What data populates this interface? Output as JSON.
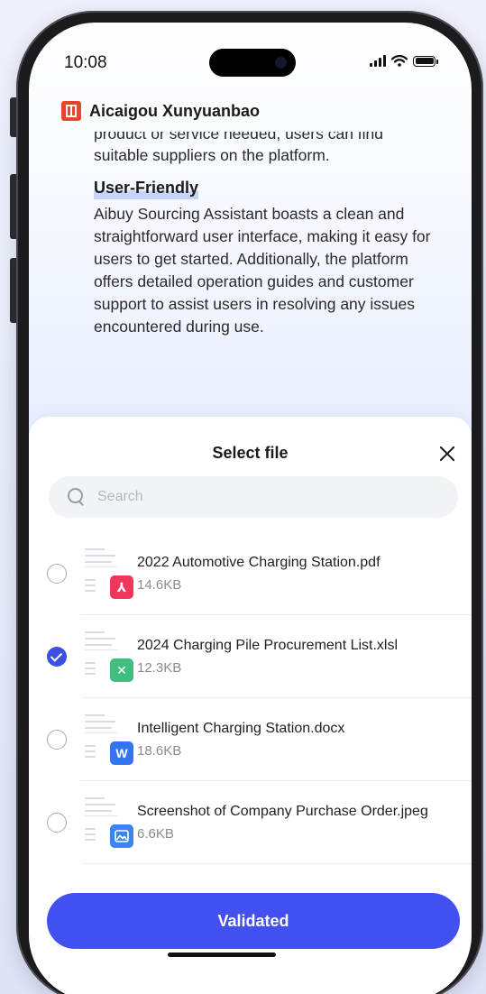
{
  "status_bar": {
    "time": "10:08"
  },
  "app": {
    "title": "Aicaigou Xunyuanbao",
    "logo_color": "#e8462c"
  },
  "article": {
    "cut_line": "product or service needed, users can find",
    "line_after_cut": "suitable suppliers on the platform.",
    "section_heading": "User-Friendly",
    "section_body": "Aibuy Sourcing Assistant boasts a clean and straightforward user interface, making it easy for users to get started. Additionally, the platform offers detailed operation guides and customer support to assist users in resolving any issues encountered during use."
  },
  "sheet": {
    "title": "Select file",
    "close_icon": "close-icon",
    "search": {
      "placeholder": "Search",
      "value": ""
    },
    "files": [
      {
        "name": "2022 Automotive Charging Station.pdf",
        "size": "14.6KB",
        "selected": false,
        "type_icon": "pdf-icon",
        "badge_color": "#f0365a",
        "badge_glyph": "⅄"
      },
      {
        "name": "2024 Charging Pile Procurement List.xlsl",
        "size": "12.3KB",
        "selected": true,
        "type_icon": "excel-icon",
        "badge_color": "#3fbf7f",
        "badge_glyph": "✕"
      },
      {
        "name": "Intelligent Charging Station.docx",
        "size": "18.6KB",
        "selected": false,
        "type_icon": "word-icon",
        "badge_color": "#3474f0",
        "badge_glyph": "W"
      },
      {
        "name": "Screenshot of Company Purchase Order.jpeg",
        "size": "6.6KB",
        "selected": false,
        "type_icon": "image-icon",
        "badge_color": "#3a85f0",
        "badge_glyph": ""
      }
    ],
    "primary_button": "Validated"
  },
  "colors": {
    "accent": "#4350f0",
    "check": "#3b4fe0"
  }
}
